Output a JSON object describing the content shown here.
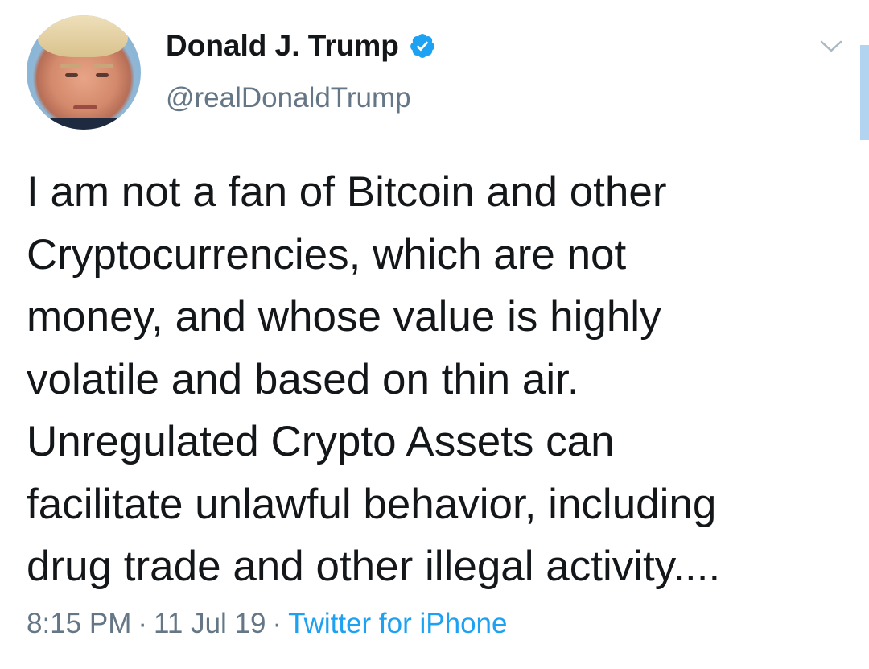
{
  "tweet": {
    "author_name": "Donald J. Trump",
    "handle": "@realDonaldTrump",
    "text_lines": [
      "I am not a fan of Bitcoin and other",
      "Cryptocurrencies, which are not",
      "money, and whose value is highly",
      "volatile and based on thin air.",
      "Unregulated Crypto Assets can",
      "facilitate unlawful behavior, including",
      "drug trade and other illegal activity...."
    ],
    "time": "8:15 PM",
    "date": "11 Jul 19",
    "separator": "·",
    "source": "Twitter for iPhone"
  },
  "icons": {
    "verified": "verified-badge-icon",
    "menu": "chevron-down-icon"
  },
  "colors": {
    "text": "#14171a",
    "secondary": "#657786",
    "accent": "#1da1f2"
  }
}
